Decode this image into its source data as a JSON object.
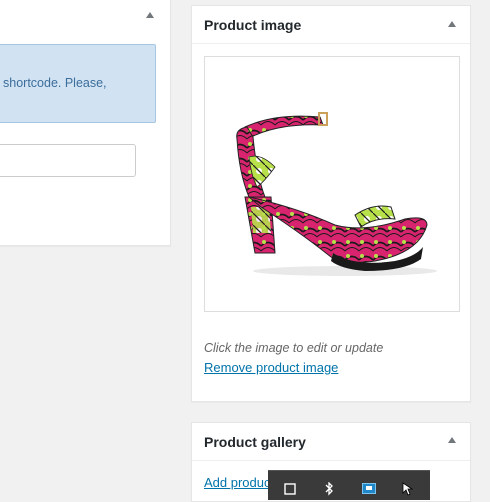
{
  "left_panel": {
    "notice_text": "shortcode. Please,",
    "shortcode_input_value": ""
  },
  "product_image": {
    "title": "Product image",
    "image_alt": "Pink and green African print high-heel ankle strap sandal",
    "hint": "Click the image to edit or update",
    "remove_link": "Remove product image"
  },
  "product_gallery": {
    "title": "Product gallery",
    "add_link": "Add product gallery images"
  },
  "taskbar": {
    "icons": [
      "window-icon",
      "bluetooth-icon",
      "network-icon",
      "cursor-icon"
    ]
  },
  "colors": {
    "background": "#f1f1f1",
    "panel": "#ffffff",
    "link": "#0073aa",
    "notice_bg": "#d1e3f3",
    "notice_text": "#3c6d9b",
    "shoe_pink": "#d8246e",
    "shoe_green": "#b8e04a",
    "shoe_black": "#1a1a1a"
  }
}
